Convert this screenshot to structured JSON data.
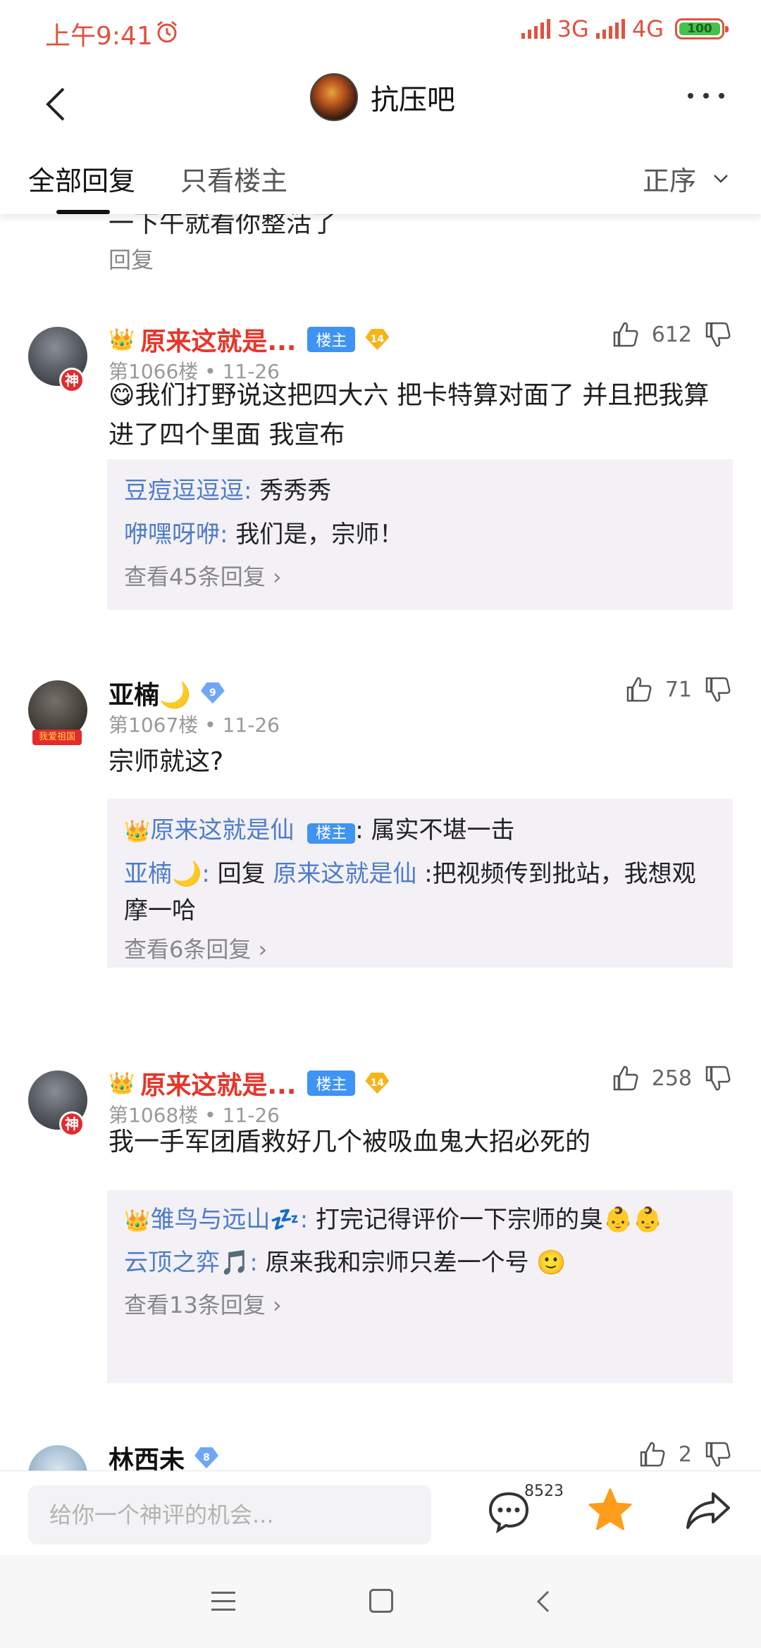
{
  "status_bar": {
    "time": "上午9:41",
    "net1": "3G",
    "net2": "4G",
    "battery": "100"
  },
  "nav": {
    "title": "抗压吧"
  },
  "tabs": {
    "all": "全部回复",
    "host_only": "只看楼主",
    "sort": "正序"
  },
  "partial_post": {
    "text": "一下午就看你整活了",
    "reply_label": "回复"
  },
  "posts": [
    {
      "author": "原来这就是...",
      "crown": "👑",
      "host_badge": "楼主",
      "level": "14",
      "floor": "第1066楼",
      "date": "11-26",
      "likes": "612",
      "emoji": "😋",
      "text": "我们打野说这把四大六 把卡特算对面了 并且把我算进了四个里面 我宣布",
      "replies": [
        {
          "name": "豆痘逗逗逗:",
          "text": "秀秀秀"
        },
        {
          "name": "咿嘿呀咿:",
          "text": "我们是，宗师！"
        }
      ],
      "more": "查看45条回复 ›"
    },
    {
      "author": "亚楠🌙",
      "level": "9",
      "floor": "第1067楼",
      "date": "11-26",
      "likes": "71",
      "text": "宗师就这?",
      "flag_text": "我爱祖国",
      "replies": [
        {
          "crown": "👑",
          "name": "原来这就是仙",
          "badge": "楼主",
          "text": ": 属实不堪一击"
        },
        {
          "name": "亚楠🌙:",
          "text": " 回复 ",
          "mention": "原来这就是仙",
          "text2": " :把视频传到批站，我想观摩一哈"
        }
      ],
      "more": "查看6条回复 ›"
    },
    {
      "author": "原来这就是...",
      "crown": "👑",
      "host_badge": "楼主",
      "level": "14",
      "floor": "第1068楼",
      "date": "11-26",
      "likes": "258",
      "text": "我一手军团盾救好几个被吸血鬼大招必死的",
      "replies": [
        {
          "crown": "👑",
          "name": "雏鸟与远山💤:",
          "text": "打完记得评价一下宗师的臭👶👶"
        },
        {
          "name": "云顶之弈🎵:",
          "text": "原来我和宗师只差一个号 🙂"
        }
      ],
      "more": "查看13条回复 ›"
    },
    {
      "author": "林西未",
      "level": "8",
      "likes": "2"
    }
  ],
  "god_badge": "神",
  "input": {
    "placeholder": "给你一个神评的机会...",
    "comment_count": "8523"
  }
}
